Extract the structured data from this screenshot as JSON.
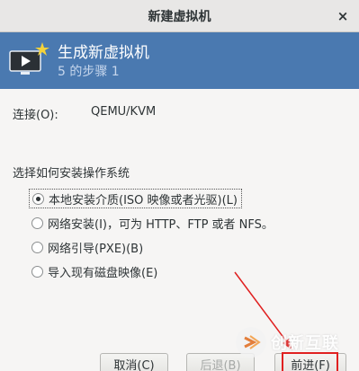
{
  "window": {
    "title": "新建虚拟机",
    "close_glyph": "×"
  },
  "banner": {
    "title": "生成新虚拟机",
    "step": "5 的步骤 1",
    "icon": "monitor-play-icon",
    "accent": "#4a79b0"
  },
  "connection": {
    "label": "连接(O):",
    "value": "QEMU/KVM"
  },
  "install": {
    "heading": "选择如何安装操作系统",
    "options": [
      {
        "label": "本地安装介质(ISO 映像或者光驱)(L)",
        "selected": true
      },
      {
        "label": "网络安装(I)，可为 HTTP、FTP 或者 NFS。",
        "selected": false
      },
      {
        "label": "网络引导(PXE)(B)",
        "selected": false
      },
      {
        "label": "导入现有磁盘映像(E)",
        "selected": false
      }
    ]
  },
  "buttons": {
    "cancel": "取消(C)",
    "back": "后退(B)",
    "forward": "前进(F)"
  },
  "watermark": {
    "text": "创新互联"
  },
  "colors": {
    "annotation": "#e02020"
  }
}
